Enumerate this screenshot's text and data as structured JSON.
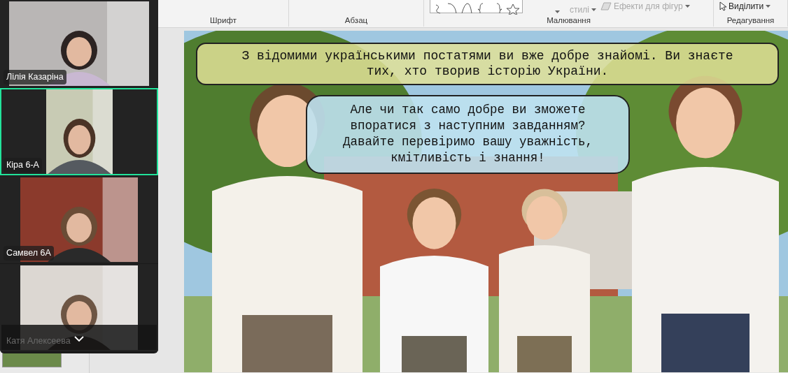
{
  "ribbon": {
    "commands": [
      {
        "label": "стилі",
        "disabled": true
      },
      {
        "label": "Ефекти для фігур",
        "disabled": true
      },
      {
        "label": "Виділити",
        "disabled": false
      }
    ],
    "groups": [
      {
        "label": "Шрифт"
      },
      {
        "label": "Абзац"
      },
      {
        "label": "Малювання"
      },
      {
        "label": "Редагування"
      }
    ]
  },
  "slide": {
    "caption": "З відомими українськими постатями ви вже добре знайомі. Ви знаєте тих, хто творив історію України.",
    "speech": "Але чи так само добре ви зможете впоратися з наступним завданням? Давайте перевіримо вашу уважність, кмітливість і знання!"
  },
  "meeting": {
    "participants": [
      {
        "name": "Лілія Казаріна",
        "selected": false,
        "dimmed": false
      },
      {
        "name": "Кіра 6-А",
        "selected": true,
        "dimmed": false
      },
      {
        "name": "Самвел 6А",
        "selected": false,
        "dimmed": false
      },
      {
        "name": "Катя Алексеева",
        "selected": false,
        "dimmed": true
      }
    ]
  }
}
